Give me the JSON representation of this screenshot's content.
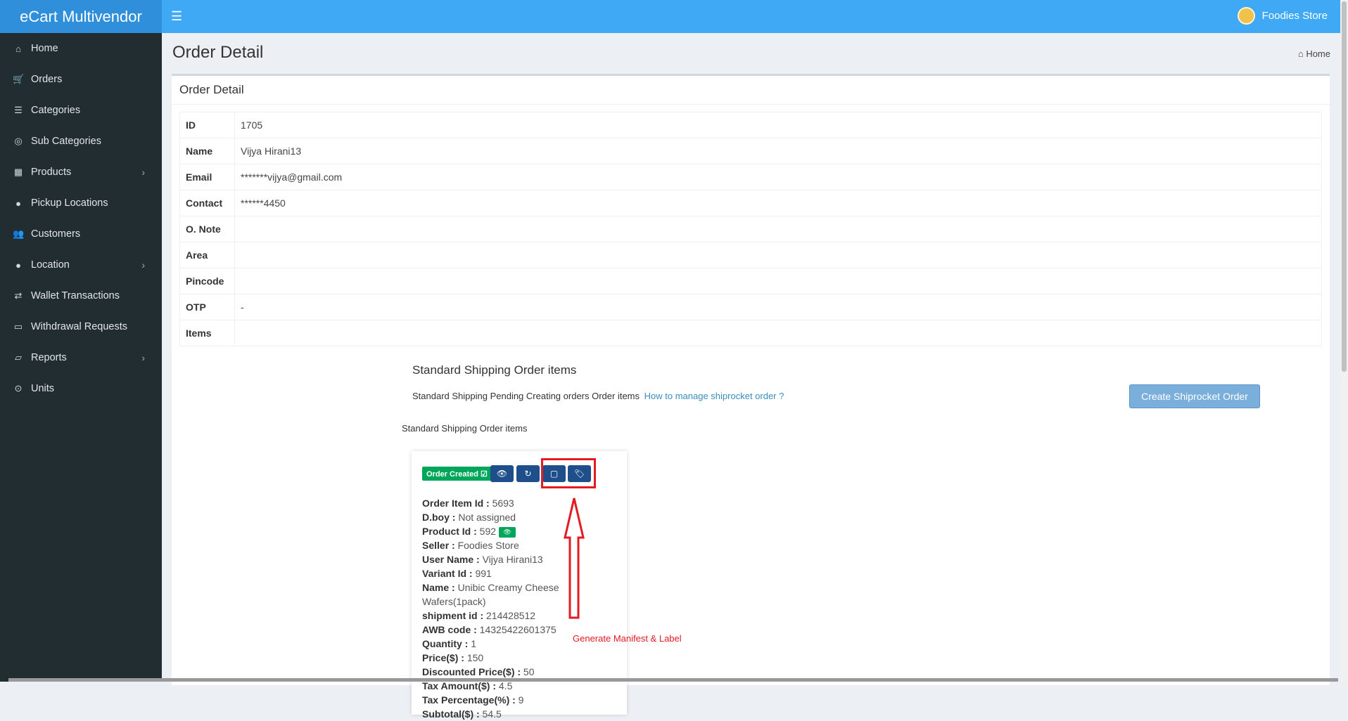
{
  "app": {
    "logo": "eCart Multivendor",
    "user_name": "Foodies Store"
  },
  "sidebar": {
    "items": [
      {
        "label": "Home",
        "icon": "home-icon",
        "glyph": "⌂",
        "chevron": false
      },
      {
        "label": "Orders",
        "icon": "cart-icon",
        "glyph": "🛒",
        "chevron": false
      },
      {
        "label": "Categories",
        "icon": "sliders-icon",
        "glyph": "☰",
        "chevron": false
      },
      {
        "label": "Sub Categories",
        "icon": "target-icon",
        "glyph": "◎",
        "chevron": false
      },
      {
        "label": "Products",
        "icon": "cubes-icon",
        "glyph": "▦",
        "chevron": true
      },
      {
        "label": "Pickup Locations",
        "icon": "map-pin-icon",
        "glyph": "●",
        "chevron": false
      },
      {
        "label": "Customers",
        "icon": "users-icon",
        "glyph": "👥",
        "chevron": false
      },
      {
        "label": "Location",
        "icon": "map-pin-icon",
        "glyph": "●",
        "chevron": true
      },
      {
        "label": "Wallet Transactions",
        "icon": "exchange-icon",
        "glyph": "⇄",
        "chevron": false
      },
      {
        "label": "Withdrawal Requests",
        "icon": "credit-card-icon",
        "glyph": "▭",
        "chevron": false
      },
      {
        "label": "Reports",
        "icon": "folder-open-icon",
        "glyph": "▱",
        "chevron": true
      },
      {
        "label": "Units",
        "icon": "dot-circle-icon",
        "glyph": "⊙",
        "chevron": false
      }
    ]
  },
  "page": {
    "title": "Order Detail",
    "breadcrumb": "Home"
  },
  "box": {
    "title": "Order Detail"
  },
  "details": [
    {
      "key": "ID",
      "value": "1705"
    },
    {
      "key": "Name",
      "value": "Vijya Hirani13"
    },
    {
      "key": "Email",
      "value": "*******vijya@gmail.com"
    },
    {
      "key": "Contact",
      "value": "******4450"
    },
    {
      "key": "O. Note",
      "value": ""
    },
    {
      "key": "Area",
      "value": ""
    },
    {
      "key": "Pincode",
      "value": ""
    },
    {
      "key": "OTP",
      "value": "-"
    }
  ],
  "items_label": "Items",
  "shipping": {
    "title": "Standard Shipping Order items",
    "desc": "Standard Shipping Pending Creating orders Order items",
    "link": "How to manage shiprocket order ?",
    "create_button": "Create Shiprocket Order",
    "subtitle": "Standard Shipping Order items"
  },
  "card": {
    "status": "Order Created ☑",
    "fields": [
      {
        "k": "Order Item Id :",
        "v": "5693"
      },
      {
        "k": "D.boy :",
        "v": "Not assigned"
      },
      {
        "k": "Product Id :",
        "v": "592"
      },
      {
        "k": "Seller :",
        "v": "Foodies Store"
      },
      {
        "k": "User Name :",
        "v": "Vijya Hirani13"
      },
      {
        "k": "Variant Id :",
        "v": "991"
      },
      {
        "k": "Name :",
        "v": "Unibic Creamy Cheese Wafers(1pack)"
      },
      {
        "k": "shipment id :",
        "v": "214428512"
      },
      {
        "k": "AWB code :",
        "v": "14325422601375"
      },
      {
        "k": "Quantity :",
        "v": "1"
      },
      {
        "k": "Price($) :",
        "v": "150"
      },
      {
        "k": "Discounted Price($) :",
        "v": "50"
      },
      {
        "k": "Tax Amount($) :",
        "v": "4.5"
      },
      {
        "k": "Tax Percentage(%) :",
        "v": "9"
      },
      {
        "k": "Subtotal($) :",
        "v": "54.5"
      }
    ]
  },
  "annotation": "Generate Manifest & Label",
  "colors": {
    "header": "#3fa9f5",
    "sidebar": "#222d32",
    "accent": "#1e4f8a",
    "success": "#00a65a",
    "annotation": "#e31b23"
  }
}
